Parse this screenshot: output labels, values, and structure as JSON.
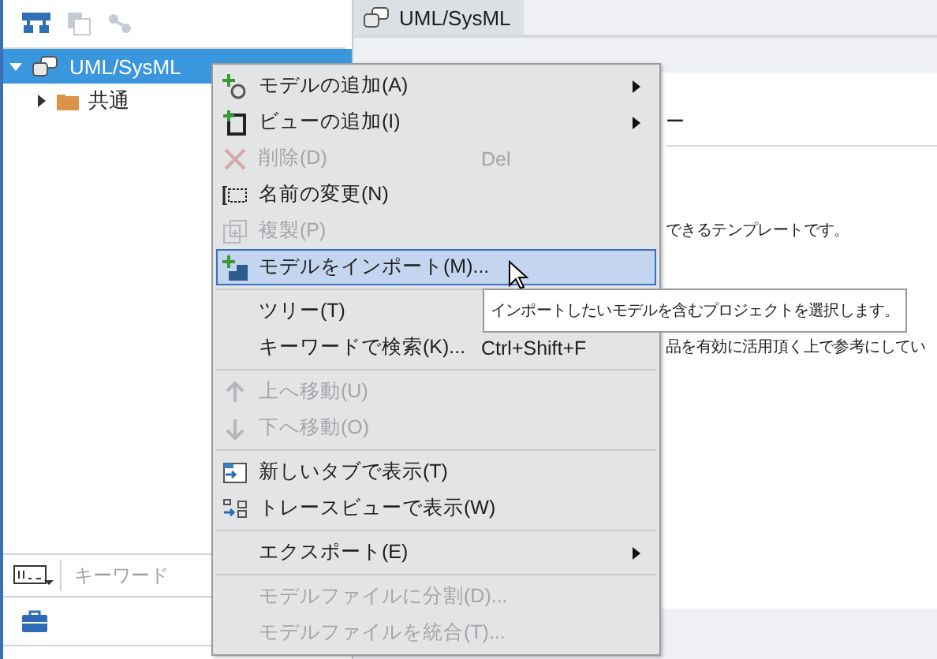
{
  "toolbar": {
    "buttons": [
      {
        "disabled": false
      },
      {
        "disabled": true
      },
      {
        "disabled": true
      }
    ]
  },
  "tree": [
    {
      "label": "UML/SysML",
      "selected": true,
      "expanded": true,
      "children": [
        {
          "label": "共通",
          "selected": false,
          "expanded": false
        }
      ]
    }
  ],
  "search": {
    "placeholder": "キーワード"
  },
  "tab": {
    "label": "UML/SysML",
    "selected": true
  },
  "content": {
    "heading_fragment": "ー",
    "lines": [
      "できるテンプレートです。",
      "品を有効に活用頂く上で参考にしてい"
    ]
  },
  "context_menu": [
    {
      "kind": "item",
      "label": "モデルの追加(A)",
      "disabled": false,
      "selected": false,
      "submenu": true
    },
    {
      "kind": "item",
      "label": "ビューの追加(I)",
      "disabled": false,
      "selected": false,
      "submenu": true
    },
    {
      "kind": "item",
      "label": "削除(D)",
      "shortcut": "Del",
      "disabled": true,
      "selected": false,
      "submenu": false
    },
    {
      "kind": "item",
      "label": "名前の変更(N)",
      "disabled": false,
      "selected": false,
      "submenu": false
    },
    {
      "kind": "item",
      "label": "複製(P)",
      "disabled": true,
      "selected": false,
      "submenu": false
    },
    {
      "kind": "item",
      "label": "モデルをインポート(M)...",
      "disabled": false,
      "selected": true,
      "submenu": false
    },
    {
      "kind": "separator"
    },
    {
      "kind": "item",
      "label": "ツリー(T)",
      "disabled": false,
      "selected": false,
      "submenu": false
    },
    {
      "kind": "item",
      "label": "キーワードで検索(K)...",
      "shortcut": "Ctrl+Shift+F",
      "disabled": false,
      "selected": false,
      "submenu": false
    },
    {
      "kind": "separator"
    },
    {
      "kind": "item",
      "label": "上へ移動(U)",
      "disabled": true,
      "selected": false,
      "submenu": false
    },
    {
      "kind": "item",
      "label": "下へ移動(O)",
      "disabled": true,
      "selected": false,
      "submenu": false
    },
    {
      "kind": "separator"
    },
    {
      "kind": "item",
      "label": "新しいタブで表示(T)",
      "disabled": false,
      "selected": false,
      "submenu": false
    },
    {
      "kind": "item",
      "label": "トレースビューで表示(W)",
      "disabled": false,
      "selected": false,
      "submenu": false
    },
    {
      "kind": "separator"
    },
    {
      "kind": "item",
      "label": "エクスポート(E)",
      "disabled": false,
      "selected": false,
      "submenu": true
    },
    {
      "kind": "separator"
    },
    {
      "kind": "item",
      "label": "モデルファイルに分割(D)...",
      "disabled": true,
      "selected": false,
      "submenu": false
    },
    {
      "kind": "item",
      "label": "モデルファイルを統合(T)...",
      "disabled": true,
      "selected": false,
      "submenu": false
    }
  ],
  "tooltip": "インポートしたいモデルを含むプロジェクトを選択します。"
}
